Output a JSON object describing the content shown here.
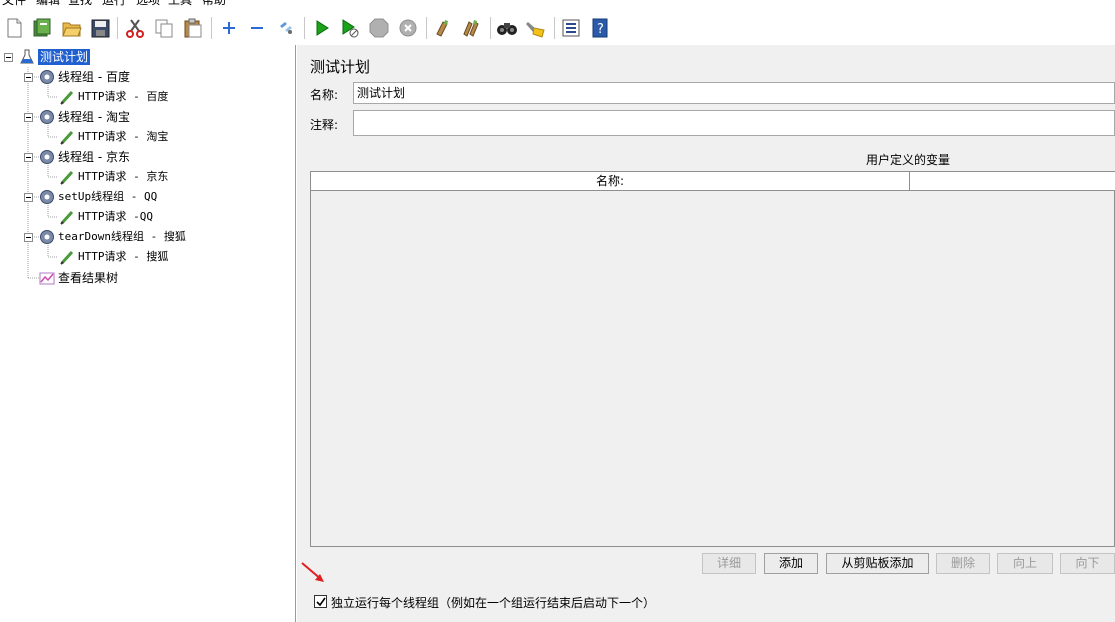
{
  "menu": [
    "文件",
    "编辑",
    "查找",
    "运行",
    "选项",
    "工具",
    "帮助"
  ],
  "toolbar_icons": [
    "new-icon",
    "templates-icon",
    "open-icon",
    "save-icon",
    "cut-icon",
    "copy-icon",
    "paste-icon",
    "expand-icon",
    "collapse-icon",
    "toggle-icon",
    "start-icon",
    "start-no-pause-icon",
    "stop-icon",
    "shutdown-icon",
    "clear-icon",
    "clear-all-icon",
    "search-icon",
    "reset-search-icon",
    "function-helper-icon",
    "help-icon"
  ],
  "tree": {
    "root": "测试计划",
    "groups": [
      {
        "label": "线程组 - 百度",
        "child": "HTTP请求 - 百度"
      },
      {
        "label": "线程组 - 淘宝",
        "child": "HTTP请求 - 淘宝"
      },
      {
        "label": "线程组 - 京东",
        "child": "HTTP请求 - 京东"
      },
      {
        "label": "setUp线程组 - QQ",
        "child": "HTTP请求 -QQ"
      },
      {
        "label": "tearDown线程组 - 搜狐",
        "child": "HTTP请求 - 搜狐"
      }
    ],
    "listener": "查看结果树"
  },
  "panel": {
    "title": "测试计划",
    "name_label": "名称:",
    "name_value": "测试计划",
    "comment_label": "注释:",
    "comment_value": "",
    "udv_title": "用户定义的变量",
    "col_name": "名称:",
    "col_value": ""
  },
  "buttons": {
    "detail": "详细",
    "add": "添加",
    "add_clipboard": "从剪贴板添加",
    "delete": "删除",
    "up": "向上",
    "down": "向下"
  },
  "options": {
    "serialize_label": "独立运行每个线程组（例如在一个组运行结束后启动下一个）",
    "serialize_checked": true
  },
  "colors": {
    "selection": "#1f5fcf",
    "panel_bg": "#f0f0f0",
    "arrow": "#e02020",
    "run_green": "#1aa31a"
  }
}
